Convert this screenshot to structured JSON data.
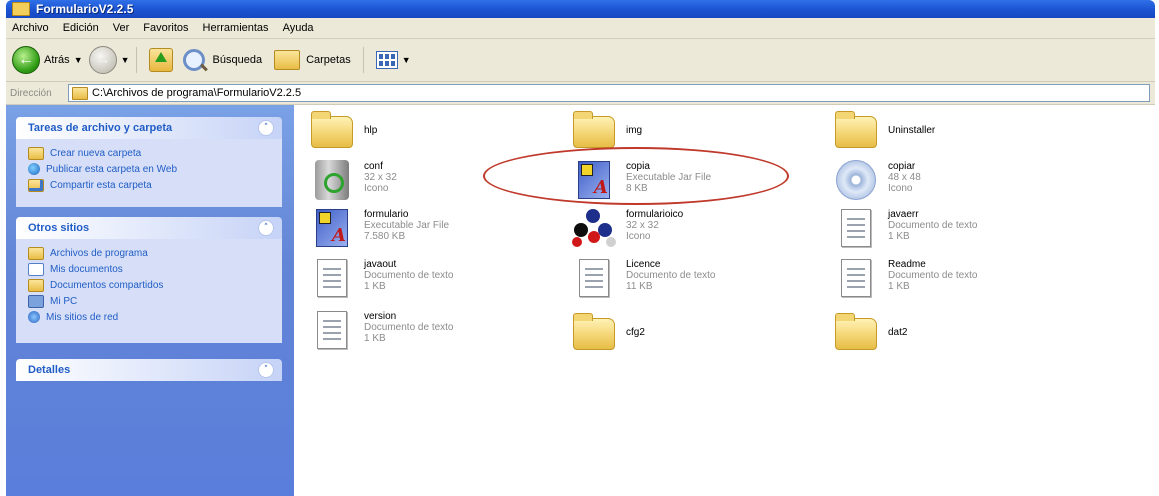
{
  "window": {
    "title": "FormularioV2.2.5"
  },
  "menu": [
    "Archivo",
    "Edición",
    "Ver",
    "Favoritos",
    "Herramientas",
    "Ayuda"
  ],
  "toolbar": {
    "back_label": "Atrás",
    "search_label": "Búsqueda",
    "folders_label": "Carpetas"
  },
  "address": {
    "label": "Dirección",
    "path": "C:\\Archivos de programa\\FormularioV2.2.5"
  },
  "tasks": {
    "title": "Tareas de archivo y carpeta",
    "items": [
      "Crear nueva carpeta",
      "Publicar esta carpeta en Web",
      "Compartir esta carpeta"
    ]
  },
  "places": {
    "title": "Otros sitios",
    "items": [
      "Archivos de programa",
      "Mis documentos",
      "Documentos compartidos",
      "Mi PC",
      "Mis sitios de red"
    ]
  },
  "details": {
    "title": "Detalles"
  },
  "files": [
    {
      "name": "hlp",
      "type": "",
      "size": "",
      "icon": "folder-icon"
    },
    {
      "name": "img",
      "type": "",
      "size": "",
      "icon": "folder-icon"
    },
    {
      "name": "Uninstaller",
      "type": "",
      "size": "",
      "icon": "folder-icon"
    },
    {
      "name": "conf",
      "type": "32 x 32",
      "size": "Icono",
      "icon": "recycle-icon"
    },
    {
      "name": "copia",
      "type": "Executable Jar File",
      "size": "8 KB",
      "icon": "jar-file-icon"
    },
    {
      "name": "copiar",
      "type": "48 x 48",
      "size": "Icono",
      "icon": "cd-icon"
    },
    {
      "name": "formulario",
      "type": "Executable Jar File",
      "size": "7.580 KB",
      "icon": "jar-file-icon"
    },
    {
      "name": "formularioico",
      "type": "32 x 32",
      "size": "Icono",
      "icon": "molecule-icon"
    },
    {
      "name": "javaerr",
      "type": "Documento de texto",
      "size": "1 KB",
      "icon": "text-document-icon"
    },
    {
      "name": "javaout",
      "type": "Documento de texto",
      "size": "1 KB",
      "icon": "text-document-icon"
    },
    {
      "name": "Licence",
      "type": "Documento de texto",
      "size": "11 KB",
      "icon": "text-document-icon"
    },
    {
      "name": "Readme",
      "type": "Documento de texto",
      "size": "1 KB",
      "icon": "text-document-icon"
    },
    {
      "name": "version",
      "type": "Documento de texto",
      "size": "1 KB",
      "icon": "text-document-icon"
    },
    {
      "name": "cfg2",
      "type": "",
      "size": "",
      "icon": "folder-icon"
    },
    {
      "name": "dat2",
      "type": "",
      "size": "",
      "icon": "folder-icon"
    }
  ]
}
